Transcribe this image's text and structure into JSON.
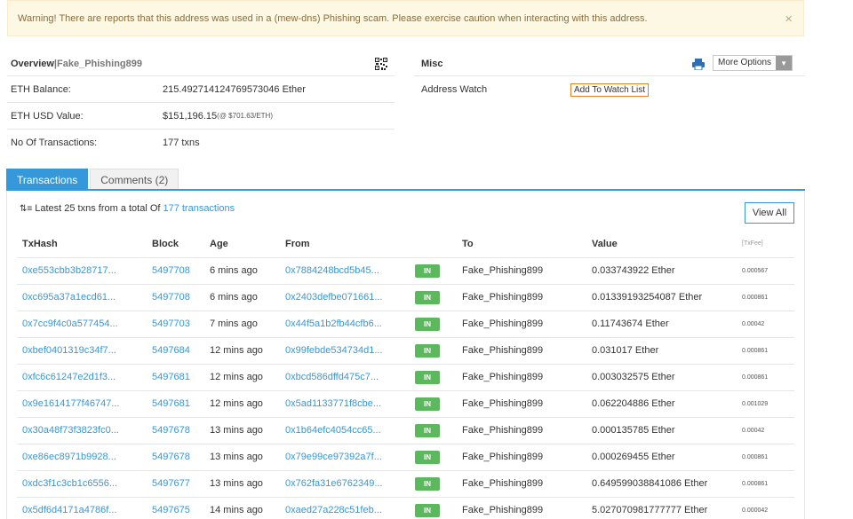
{
  "warning": {
    "text": "Warning! There are reports that this address was used in a (mew-dns) Phishing scam. Please exercise caution when interacting with this address.",
    "close": "×"
  },
  "overview": {
    "title": "Overview",
    "separator": " | ",
    "name": "Fake_Phishing899",
    "rows": [
      {
        "label": "ETH Balance:",
        "value": "215.492714124769573046 Ether",
        "extra": ""
      },
      {
        "label": "ETH USD Value:",
        "value": "$151,196.15",
        "extra": " (@ $701.63/ETH)"
      },
      {
        "label": "No Of Transactions:",
        "value": "177 txns",
        "extra": ""
      }
    ]
  },
  "misc": {
    "title": "Misc",
    "more_options": "More Options",
    "address_watch_label": "Address Watch",
    "watch_button": "Add To Watch List"
  },
  "tabs": {
    "transactions": "Transactions",
    "comments": "Comments (2)"
  },
  "summary": {
    "prefix": "Latest 25 txns from a total Of",
    "link": "177 transactions",
    "view_all": "View All"
  },
  "table": {
    "headers": [
      "TxHash",
      "Block",
      "Age",
      "From",
      "",
      "To",
      "Value",
      "[TxFee]"
    ],
    "rows": [
      {
        "hash": "0xe553cbb3b28717...",
        "block": "5497708",
        "age": "6 mins ago",
        "from": "0x7884248bcd5b45...",
        "dir": "IN",
        "to": "Fake_Phishing899",
        "value": "0.033743922 Ether",
        "fee": "0.000567"
      },
      {
        "hash": "0xc695a37a1ecd61...",
        "block": "5497708",
        "age": "6 mins ago",
        "from": "0x2403defbe071661...",
        "dir": "IN",
        "to": "Fake_Phishing899",
        "value": "0.01339193254087 Ether",
        "fee": "0.000861"
      },
      {
        "hash": "0x7cc9f4c0a577454...",
        "block": "5497703",
        "age": "7 mins ago",
        "from": "0x44f5a1b2fb44cfb6...",
        "dir": "IN",
        "to": "Fake_Phishing899",
        "value": "0.11743674 Ether",
        "fee": "0.00042"
      },
      {
        "hash": "0xbef0401319c34f7...",
        "block": "5497684",
        "age": "12 mins ago",
        "from": "0x99febde534734d1...",
        "dir": "IN",
        "to": "Fake_Phishing899",
        "value": "0.031017 Ether",
        "fee": "0.000861"
      },
      {
        "hash": "0xfc6c61247e2d1f3...",
        "block": "5497681",
        "age": "12 mins ago",
        "from": "0xbcd586dffd475c7...",
        "dir": "IN",
        "to": "Fake_Phishing899",
        "value": "0.003032575 Ether",
        "fee": "0.000861"
      },
      {
        "hash": "0x9e1614177f46747...",
        "block": "5497681",
        "age": "12 mins ago",
        "from": "0x5ad1133771f8cbe...",
        "dir": "IN",
        "to": "Fake_Phishing899",
        "value": "0.062204886 Ether",
        "fee": "0.001029"
      },
      {
        "hash": "0x30a48f73f3823fc0...",
        "block": "5497678",
        "age": "13 mins ago",
        "from": "0x1b64efc4054cc65...",
        "dir": "IN",
        "to": "Fake_Phishing899",
        "value": "0.000135785 Ether",
        "fee": "0.00042"
      },
      {
        "hash": "0xe86ec8971b9928...",
        "block": "5497678",
        "age": "13 mins ago",
        "from": "0x79e99ce97392a7f...",
        "dir": "IN",
        "to": "Fake_Phishing899",
        "value": "0.000269455 Ether",
        "fee": "0.000861"
      },
      {
        "hash": "0xdc3f1c3cb1c6556...",
        "block": "5497677",
        "age": "13 mins ago",
        "from": "0x762fa31e6762349...",
        "dir": "IN",
        "to": "Fake_Phishing899",
        "value": "0.649599038841086 Ether",
        "fee": "0.000861"
      },
      {
        "hash": "0x5df6d4171a4786f...",
        "block": "5497675",
        "age": "14 mins ago",
        "from": "0xaed27a228c51feb...",
        "dir": "IN",
        "to": "Fake_Phishing899",
        "value": "5.027070981777777 Ether",
        "fee": "0.000042"
      }
    ]
  },
  "colors": {
    "accent": "#3498db",
    "in_badge": "#5cb85c",
    "warning_bg": "#fcf8e3",
    "watch_border": "#e67e22"
  }
}
